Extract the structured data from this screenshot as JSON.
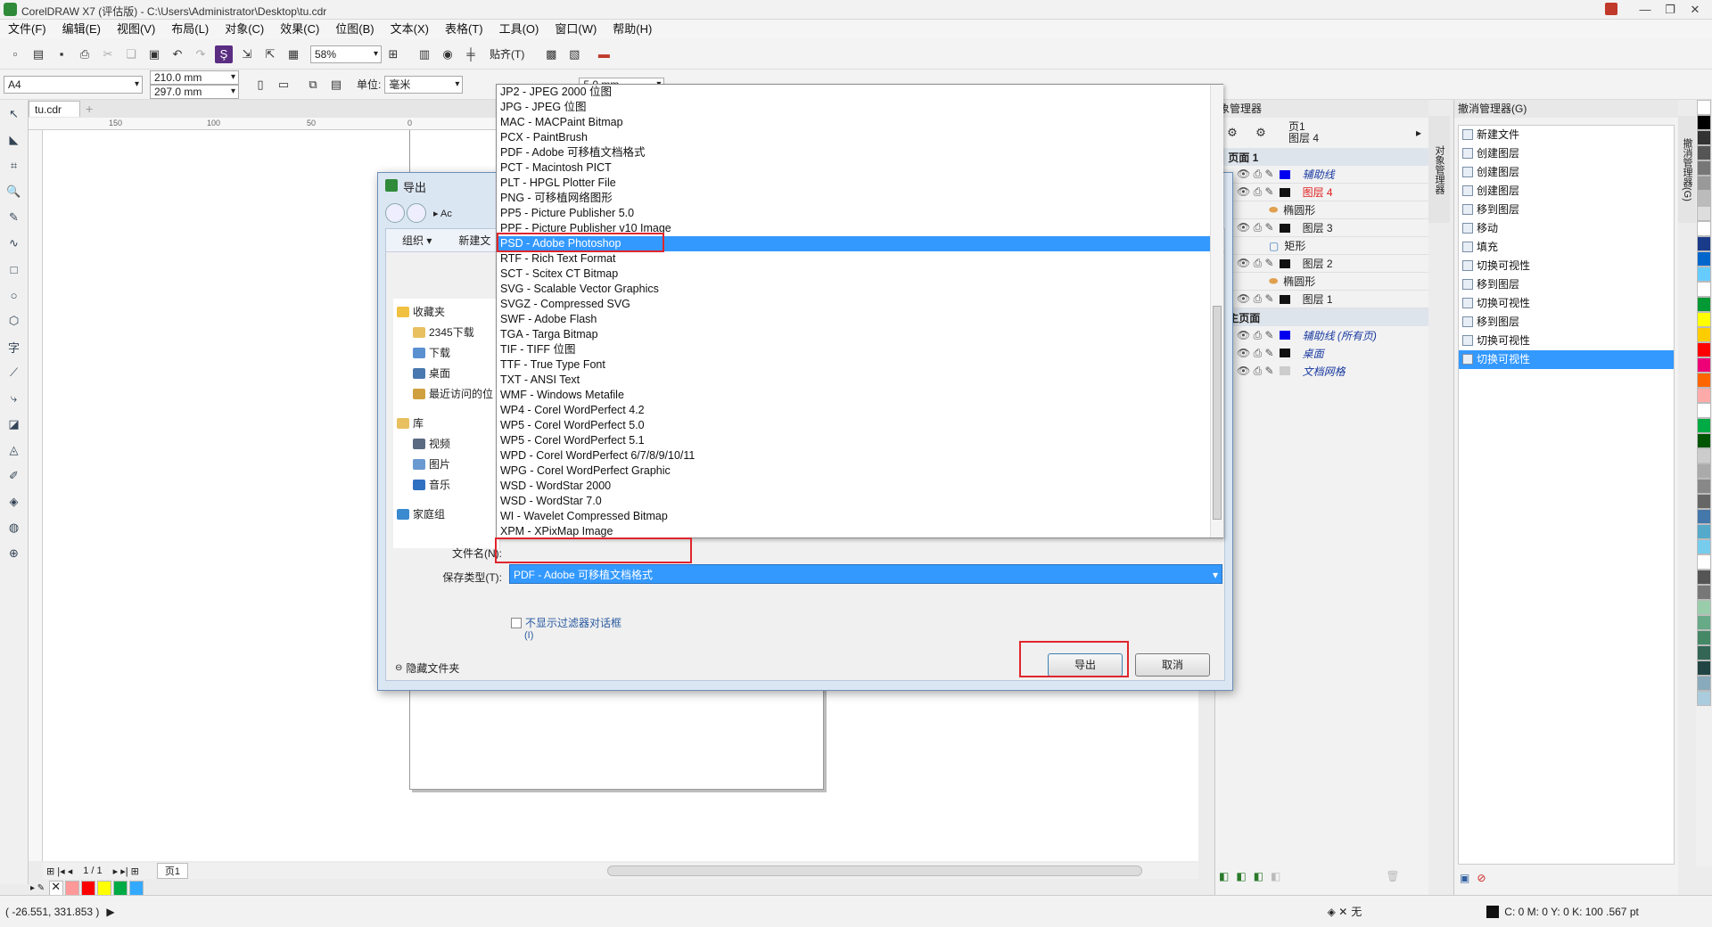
{
  "window": {
    "title": "CorelDRAW X7 (评估版) - C:\\Users\\Administrator\\Desktop\\tu.cdr"
  },
  "menu": [
    "文件(F)",
    "编辑(E)",
    "视图(V)",
    "布局(L)",
    "对象(C)",
    "效果(C)",
    "位图(B)",
    "文本(X)",
    "表格(T)",
    "工具(O)",
    "窗口(W)",
    "帮助(H)"
  ],
  "toolbar1": {
    "zoom": "58%",
    "snap": "贴齐(T)"
  },
  "toolbar2": {
    "page_size": "A4",
    "width": "210.0 mm",
    "height": "297.0 mm",
    "unit_label": "单位:",
    "unit": "毫米",
    "nudge": "5.0 mm"
  },
  "doc_tab": "tu.cdr",
  "ruler_ticks": [
    "150",
    "100",
    "50",
    "0"
  ],
  "object_manager": {
    "title": "象管理器",
    "page_label": "页1",
    "layer_label": "图层 4",
    "page1": "页面 1",
    "layers": [
      {
        "name": "辅助线",
        "color": "#0000ee",
        "style": "italic"
      },
      {
        "name": "图层 4",
        "color": "#111111",
        "style": "red"
      },
      {
        "name": "椭圆形",
        "color": "",
        "style": "child"
      },
      {
        "name": "图层 3",
        "color": "#111111",
        "style": ""
      },
      {
        "name": "矩形",
        "color": "",
        "style": "child"
      },
      {
        "name": "图层 2",
        "color": "#111111",
        "style": ""
      },
      {
        "name": "椭圆形",
        "color": "",
        "style": "child"
      },
      {
        "name": "图层 1",
        "color": "#111111",
        "style": ""
      }
    ],
    "master_page": "主页面",
    "master_layers": [
      {
        "name": "辅助线 (所有页)",
        "color": "#0000ee"
      },
      {
        "name": "桌面",
        "color": "#111111"
      },
      {
        "name": "文档网格",
        "color": "#cccccc"
      }
    ],
    "side_tab": "对象管理器"
  },
  "undo_manager": {
    "title": "撤消管理器(G)",
    "items": [
      "新建文件",
      "创建图层",
      "创建图层",
      "创建图层",
      "移到图层",
      "移动",
      "填充",
      "切换可视性",
      "移到图层",
      "切换可视性",
      "移到图层",
      "切换可视性",
      "切换可视性"
    ],
    "active_index": 12,
    "side_tab": "撤消管理器(G)"
  },
  "palette_colors": [
    "#ffffff",
    "#000000",
    "#333333",
    "#555555",
    "#777777",
    "#999999",
    "#bbbbbb",
    "#dddddd",
    "#ffffff",
    "#1a3a8a",
    "#0066cc",
    "#66ccff",
    "#ffffff",
    "#009933",
    "#ffff00",
    "#ffcc00",
    "#ff0000",
    "#ee0077",
    "#ff6600",
    "#ffaaaa",
    "#ffffff",
    "#00aa44",
    "#005500",
    "#cccccc",
    "#aaaaaa",
    "#888888",
    "#666666",
    "#4477aa",
    "#55aacc",
    "#77ccee",
    "#ffffff",
    "#555555",
    "#777777",
    "#99ccaa",
    "#66aa88",
    "#448866",
    "#336655",
    "#224444",
    "#88aabb",
    "#aaccdd"
  ],
  "doc_nav": {
    "page_count": "1 / 1",
    "page_tab": "页1"
  },
  "bottom_colors": [
    "#ff9999",
    "#ff0000",
    "#ffff00",
    "#00aa44",
    "#33aaff"
  ],
  "status": {
    "coords": "( -26.551, 331.853 )",
    "fill": "无",
    "outline": "C: 0 M: 0 Y: 0 K: 100  .567 pt"
  },
  "dialog": {
    "title": "导出",
    "path": "Ac",
    "organize": "组织 ▾",
    "new_folder": "新建文",
    "nav": [
      {
        "label": "收藏夹",
        "color": "#f0c040"
      },
      {
        "label": "2345下载",
        "color": "#e8c060"
      },
      {
        "label": "下载",
        "color": "#5a8fd0"
      },
      {
        "label": "桌面",
        "color": "#4a78b0"
      },
      {
        "label": "最近访问的位",
        "color": "#d0a040"
      },
      {
        "label": "库",
        "color": "#e8c060"
      },
      {
        "label": "视频",
        "color": "#5a6a80"
      },
      {
        "label": "图片",
        "color": "#6a9ad0"
      },
      {
        "label": "音乐",
        "color": "#3070c0"
      },
      {
        "label": "家庭组",
        "color": "#3a8ad0"
      }
    ],
    "filename_label": "文件名(N):",
    "savetype_label": "保存类型(T):",
    "savetype_value": "PDF - Adobe 可移植文档格式",
    "checkbox_label": "不显示过滤器对话框",
    "checkbox_hint": "(I)",
    "hide_folders": "隐藏文件夹",
    "export_button": "导出",
    "cancel_button": "取消"
  },
  "filetype_options": [
    "JP2 - JPEG 2000 位图",
    "JPG - JPEG 位图",
    "MAC - MACPaint Bitmap",
    "PCX - PaintBrush",
    "PDF - Adobe 可移植文档格式",
    "PCT - Macintosh PICT",
    "PLT - HPGL Plotter File",
    "PNG - 可移植网络图形",
    "PP5 - Picture Publisher 5.0",
    "PPF - Picture Publisher v10 Image",
    "PSD - Adobe Photoshop",
    "RTF - Rich Text Format",
    "SCT - Scitex CT Bitmap",
    "SVG - Scalable Vector Graphics",
    "SVGZ - Compressed SVG",
    "SWF - Adobe Flash",
    "TGA - Targa Bitmap",
    "TIF - TIFF 位图",
    "TTF - True Type Font",
    "TXT - ANSI Text",
    "WMF - Windows Metafile",
    "WP4 - Corel WordPerfect 4.2",
    "WP5 - Corel WordPerfect 5.0",
    "WP5 - Corel WordPerfect 5.1",
    "WPD - Corel WordPerfect 6/7/8/9/10/11",
    "WPG - Corel WordPerfect Graphic",
    "WSD - WordStar 2000",
    "WSD - WordStar 7.0",
    "WI - Wavelet Compressed Bitmap",
    "XPM - XPixMap Image"
  ],
  "highlighted_option": 10,
  "colors": {
    "accent": "#3399ff",
    "highlight_box": "#e0262d"
  }
}
